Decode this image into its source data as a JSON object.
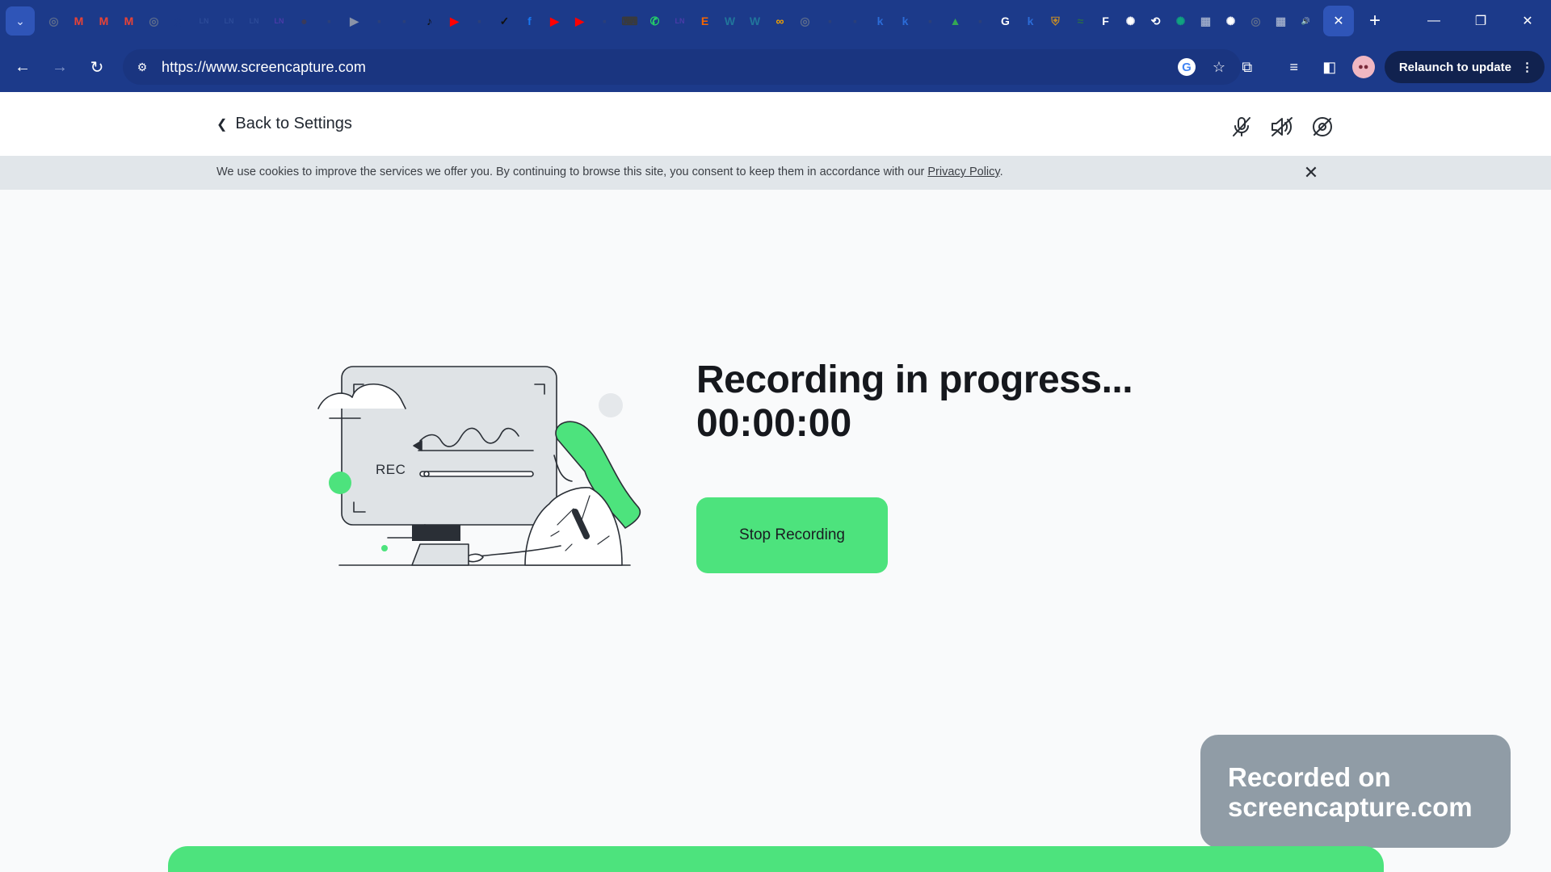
{
  "browser": {
    "url": "https://www.screencapture.com",
    "relaunch_label": "Relaunch to update",
    "pinned_tabs": [
      {
        "icon": "globe-icon",
        "color": "#5b6b8c",
        "glyph": "◎"
      },
      {
        "icon": "gmail-icon",
        "color": "#ea4335",
        "glyph": "M"
      },
      {
        "icon": "gmail-icon",
        "color": "#ea4335",
        "glyph": "M"
      },
      {
        "icon": "gmail-icon",
        "color": "#ea4335",
        "glyph": "M"
      },
      {
        "icon": "globe-icon",
        "color": "#5b6b8c",
        "glyph": "◎"
      },
      {
        "icon": "threads-icon",
        "color": "#1c3a8a",
        "glyph": "@"
      },
      {
        "icon": "linkedin-icon",
        "color": "#2b4a98",
        "glyph": "LN"
      },
      {
        "icon": "linkedin-icon",
        "color": "#2b4a98",
        "glyph": "LN"
      },
      {
        "icon": "linkedin-icon",
        "color": "#2b4a98",
        "glyph": "LN"
      },
      {
        "icon": "linkedin-icon",
        "color": "#4a3aa8",
        "glyph": "LN"
      },
      {
        "icon": "app-icon",
        "color": "#3a3a5a",
        "glyph": "●"
      },
      {
        "icon": "app-icon",
        "color": "#2a3f7a",
        "glyph": "▪"
      },
      {
        "icon": "video-icon",
        "color": "#8a93a8",
        "glyph": "▶"
      },
      {
        "icon": "app-icon",
        "color": "#2a3f7a",
        "glyph": "▪"
      },
      {
        "icon": "app-icon",
        "color": "#2a3f7a",
        "glyph": "▪"
      },
      {
        "icon": "tiktok-icon",
        "color": "#111111",
        "glyph": "♪"
      },
      {
        "icon": "youtube-icon",
        "color": "#ff0000",
        "glyph": "▶"
      },
      {
        "icon": "app-icon",
        "color": "#2a3f7a",
        "glyph": "▪"
      },
      {
        "icon": "check-icon",
        "color": "#111111",
        "glyph": "✓"
      },
      {
        "icon": "facebook-icon",
        "color": "#1877f2",
        "glyph": "f"
      },
      {
        "icon": "youtube-icon",
        "color": "#ff0000",
        "glyph": "▶"
      },
      {
        "icon": "youtube-icon",
        "color": "#ff0000",
        "glyph": "▶"
      },
      {
        "icon": "app-icon",
        "color": "#2a3f7a",
        "glyph": "▪"
      },
      {
        "icon": "keyboard-icon",
        "color": "#3a3a3a",
        "glyph": "⌨"
      },
      {
        "icon": "whatsapp-icon",
        "color": "#25d366",
        "glyph": "✆"
      },
      {
        "icon": "linkedin-icon",
        "color": "#4a3aa8",
        "glyph": "LN"
      },
      {
        "icon": "etsy-icon",
        "color": "#f56400",
        "glyph": "E"
      },
      {
        "icon": "wordpress-icon",
        "color": "#21759b",
        "glyph": "W"
      },
      {
        "icon": "wordpress-icon",
        "color": "#21759b",
        "glyph": "W"
      },
      {
        "icon": "infinity-icon",
        "color": "#f4a300",
        "glyph": "∞"
      },
      {
        "icon": "globe-icon",
        "color": "#5b6b8c",
        "glyph": "◎"
      },
      {
        "icon": "app-icon",
        "color": "#2a3f7a",
        "glyph": "▪"
      },
      {
        "icon": "app-icon",
        "color": "#2a3f7a",
        "glyph": "▪"
      },
      {
        "icon": "k-icon",
        "color": "#2b6cd8",
        "glyph": "k"
      },
      {
        "icon": "k-icon",
        "color": "#2b6cd8",
        "glyph": "k"
      },
      {
        "icon": "app-icon",
        "color": "#2a3f7a",
        "glyph": "▪"
      },
      {
        "icon": "drive-icon",
        "color": "#34a853",
        "glyph": "▲"
      },
      {
        "icon": "app-icon",
        "color": "#2a3f7a",
        "glyph": "▪"
      },
      {
        "icon": "google-icon",
        "color": "#ffffff",
        "glyph": "G"
      },
      {
        "icon": "k-icon",
        "color": "#2b6cd8",
        "glyph": "k"
      },
      {
        "icon": "shield-icon",
        "color": "#c08a2a",
        "glyph": "⛨"
      },
      {
        "icon": "app-icon",
        "color": "#2a6a4a",
        "glyph": "≈"
      },
      {
        "icon": "app-icon",
        "color": "#ffffff",
        "glyph": "F"
      },
      {
        "icon": "chatgpt-icon",
        "color": "#ffffff",
        "glyph": "✺"
      },
      {
        "icon": "history-icon",
        "color": "#ffffff",
        "glyph": "⟲"
      },
      {
        "icon": "chatgpt-icon",
        "color": "#10a37f",
        "glyph": "✺"
      },
      {
        "icon": "image-icon",
        "color": "#9aa8c8",
        "glyph": "▦"
      },
      {
        "icon": "chatgpt-icon",
        "color": "#ffffff",
        "glyph": "✺"
      },
      {
        "icon": "globe-icon",
        "color": "#5b6b8c",
        "glyph": "◎"
      },
      {
        "icon": "image-icon",
        "color": "#9aa8c8",
        "glyph": "▦"
      },
      {
        "icon": "speaker-icon",
        "color": "#ffffff",
        "glyph": "🔊"
      }
    ]
  },
  "page": {
    "back_label": "Back to Settings",
    "cookie_text": "We use cookies to improve the services we offer you. By continuing to browse this site, you consent to keep them in accordance with our",
    "cookie_link": "Privacy Policy",
    "cookie_end": ".",
    "title": "Recording in progress...",
    "timer": "00:00:00",
    "stop_label": "Stop Recording",
    "watermark_line1": "Recorded on",
    "watermark_line2": "screencapture.com",
    "illustration_rec_label": "REC",
    "accent_color": "#4de37d"
  }
}
